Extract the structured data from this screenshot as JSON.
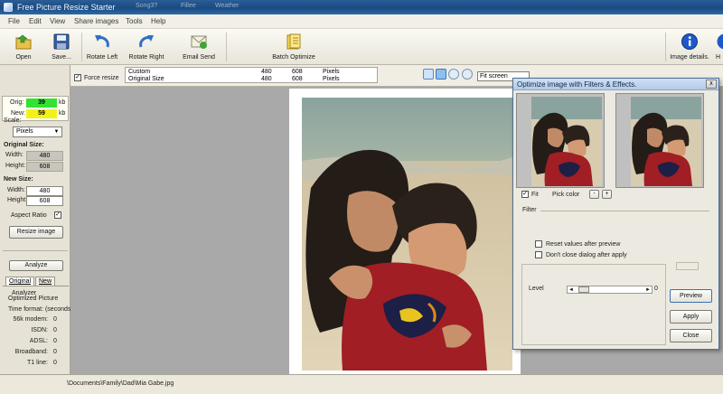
{
  "window": {
    "title": "Free Picture Resize Starter",
    "ghost_tabs": [
      "Song3?",
      "Fillee",
      "Weather"
    ]
  },
  "menu": {
    "file": "File",
    "edit": "Edit",
    "view": "View",
    "share_images": "Share images",
    "tools": "Tools",
    "help": "Help"
  },
  "toolbar": {
    "open": "Open",
    "save": "Save...",
    "rotate_left": "Rotate Left",
    "rotate_right": "Rotate Right",
    "email_send": "Email Send",
    "batch_optimize": "Batch Optimize",
    "image_details": "Image details.",
    "help_cut": "H"
  },
  "left_panel": {
    "orig_label": "Orig:",
    "orig_value": "39",
    "new_label": "New:",
    "new_value": "59",
    "kb_unit": "kb",
    "scale_label": "Scale:",
    "scale_value": "Pixels",
    "original_size_label": "Original Size:",
    "width_label": "Width:",
    "height_label": "Height:",
    "original_width": "480",
    "original_height": "608",
    "new_size_label": "New Size:",
    "new_width": "480",
    "new_height": "608",
    "aspect_ratio_label": "Aspect Ratio",
    "resize_button": "Resize image",
    "analyze_button": "Analyze",
    "tab_original": "Original",
    "tab_new": "New",
    "analyzer_label": "Analyzer",
    "optimized_picture": "Optimized Picture",
    "time_format": "Time format: (seconds)",
    "rows": [
      {
        "label": "56k modem:",
        "value": "0"
      },
      {
        "label": "ISDN:",
        "value": "0"
      },
      {
        "label": "ADSL:",
        "value": "0"
      },
      {
        "label": "Broadband:",
        "value": "0"
      },
      {
        "label": "T1 line:",
        "value": "0"
      }
    ]
  },
  "options_bar": {
    "force_resize": "Force resize",
    "rows": [
      {
        "name": "Custom",
        "w": "480",
        "h": "608",
        "unit": "Pixels"
      },
      {
        "name": "Original Size",
        "w": "480",
        "h": "608",
        "unit": "Pixels"
      }
    ],
    "zoom": "Fit screen"
  },
  "status_bar": {
    "path": "\\Documents\\Family\\Dad\\Mia Gabe.jpg"
  },
  "dialog": {
    "title": "Optimize image with Filters & Effects.",
    "close": "x",
    "fit_label": "Fit",
    "pick_color_label": "Pick color",
    "filter_label": "Filter",
    "reset_values_label": "Reset values after preview",
    "dont_close_label": "Don't close dialog after apply",
    "level_label": "Level",
    "level_value": "0",
    "level_fraction": 0.0,
    "preview_button": "Preview",
    "apply_button": "Apply",
    "close_button": "Close",
    "small_btn_minus": "-",
    "small_btn_plus": "+"
  },
  "colors": {
    "orig_badge": "#33e233",
    "new_badge": "#f2f21a",
    "title_bar": "#1d4f86",
    "canvas_bg": "#a9a9a9"
  }
}
